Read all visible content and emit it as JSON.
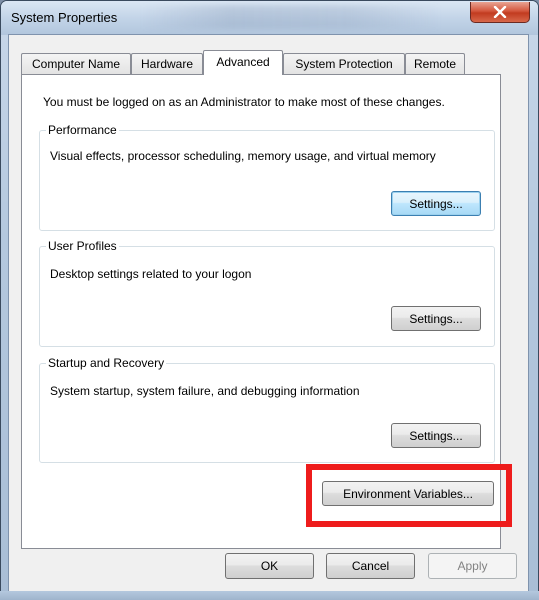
{
  "window": {
    "title": "System Properties"
  },
  "tabs": [
    {
      "label": "Computer Name"
    },
    {
      "label": "Hardware"
    },
    {
      "label": "Advanced"
    },
    {
      "label": "System Protection"
    },
    {
      "label": "Remote"
    }
  ],
  "active_tab": "Advanced",
  "advanced": {
    "admin_notice": "You must be logged on as an Administrator to make most of these changes.",
    "performance": {
      "title": "Performance",
      "description": "Visual effects, processor scheduling, memory usage, and virtual memory",
      "button": "Settings..."
    },
    "user_profiles": {
      "title": "User Profiles",
      "description": "Desktop settings related to your logon",
      "button": "Settings..."
    },
    "startup_recovery": {
      "title": "Startup and Recovery",
      "description": "System startup, system failure, and debugging information",
      "button": "Settings..."
    },
    "env_button": "Environment Variables..."
  },
  "footer": {
    "ok": "OK",
    "cancel": "Cancel",
    "apply": "Apply"
  },
  "colors": {
    "highlight": "#ee1c1c",
    "close_button": "#c7432a",
    "focus_border": "#3c7fb1"
  },
  "icons": {
    "close": "close-x-icon"
  }
}
